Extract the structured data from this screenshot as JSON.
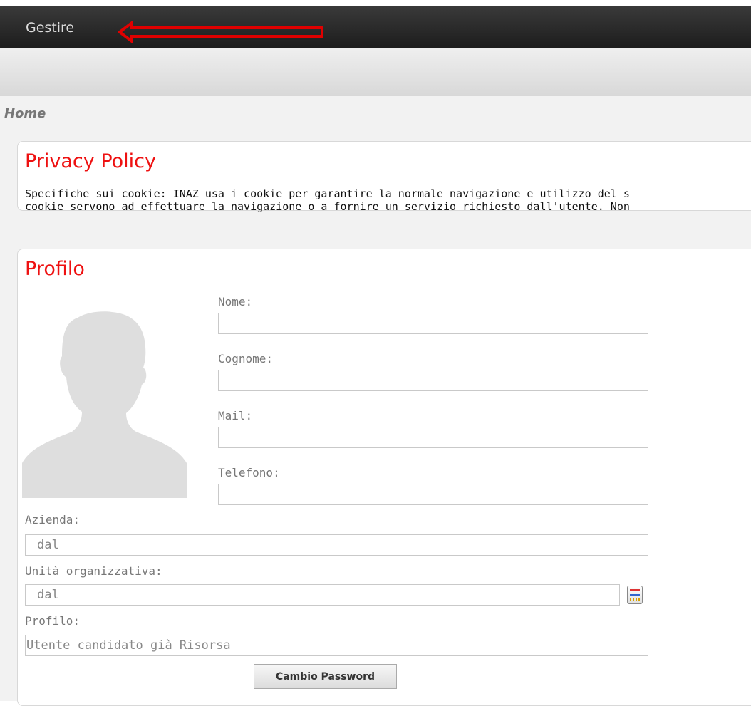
{
  "header": {
    "menu_label": "Gestire"
  },
  "breadcrumb": "Home",
  "privacy": {
    "title": "Privacy Policy",
    "line1": "Specifiche sui cookie: INAZ usa i cookie per garantire la normale navigazione e utilizzo del s",
    "line2": "cookie servono ad effettuare la navigazione o a fornire un servizio richiesto dall'utente. Non"
  },
  "profile": {
    "title": "Profilo",
    "fields": {
      "nome_label": "Nome:",
      "nome_value": "",
      "cognome_label": "Cognome:",
      "cognome_value": "",
      "mail_label": "Mail:",
      "mail_value": "",
      "telefono_label": "Telefono:",
      "telefono_value": "",
      "azienda_label": "Azienda:",
      "azienda_value": "dal",
      "unita_label": "Unità organizzativa:",
      "unita_value": "dal",
      "profilo_label": "Profilo:",
      "profilo_value": "Utente candidato già Risorsa"
    },
    "change_password_label": "Cambio Password"
  },
  "icons": [
    "arrow-left-icon",
    "avatar-placeholder",
    "calendar-icon"
  ],
  "colors": {
    "accent": "#ee1111",
    "header_bg": "#2a2a2a",
    "arrow": "#e00000"
  }
}
